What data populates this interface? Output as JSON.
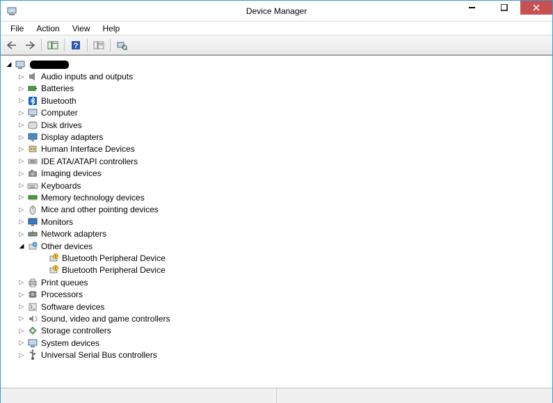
{
  "window": {
    "title": "Device Manager"
  },
  "menubar": {
    "items": [
      "File",
      "Action",
      "View",
      "Help"
    ]
  },
  "toolbar": {
    "buttons": [
      "back",
      "forward",
      "show-hide-console",
      "help",
      "properties",
      "scan-hardware"
    ]
  },
  "tree": {
    "root": {
      "label": "",
      "icon": "computer",
      "expanded": true,
      "redacted": true
    },
    "nodes": [
      {
        "label": "Audio inputs and outputs",
        "icon": "audio",
        "expanded": false,
        "children": []
      },
      {
        "label": "Batteries",
        "icon": "battery",
        "expanded": false,
        "children": []
      },
      {
        "label": "Bluetooth",
        "icon": "bluetooth",
        "expanded": false,
        "children": []
      },
      {
        "label": "Computer",
        "icon": "computer",
        "expanded": false,
        "children": []
      },
      {
        "label": "Disk drives",
        "icon": "disk",
        "expanded": false,
        "children": []
      },
      {
        "label": "Display adapters",
        "icon": "display",
        "expanded": false,
        "children": []
      },
      {
        "label": "Human Interface Devices",
        "icon": "hid",
        "expanded": false,
        "children": []
      },
      {
        "label": "IDE ATA/ATAPI controllers",
        "icon": "ide",
        "expanded": false,
        "children": []
      },
      {
        "label": "Imaging devices",
        "icon": "imaging",
        "expanded": false,
        "children": []
      },
      {
        "label": "Keyboards",
        "icon": "keyboard",
        "expanded": false,
        "children": []
      },
      {
        "label": "Memory technology devices",
        "icon": "memory",
        "expanded": false,
        "children": []
      },
      {
        "label": "Mice and other pointing devices",
        "icon": "mouse",
        "expanded": false,
        "children": []
      },
      {
        "label": "Monitors",
        "icon": "monitor",
        "expanded": false,
        "children": []
      },
      {
        "label": "Network adapters",
        "icon": "network",
        "expanded": false,
        "children": []
      },
      {
        "label": "Other devices",
        "icon": "other",
        "expanded": true,
        "children": [
          {
            "label": "Bluetooth Peripheral Device",
            "icon": "unknown"
          },
          {
            "label": "Bluetooth Peripheral Device",
            "icon": "unknown"
          }
        ]
      },
      {
        "label": "Print queues",
        "icon": "printer",
        "expanded": false,
        "children": []
      },
      {
        "label": "Processors",
        "icon": "cpu",
        "expanded": false,
        "children": []
      },
      {
        "label": "Software devices",
        "icon": "software",
        "expanded": false,
        "children": []
      },
      {
        "label": "Sound, video and game controllers",
        "icon": "sound",
        "expanded": false,
        "children": []
      },
      {
        "label": "Storage controllers",
        "icon": "storage",
        "expanded": false,
        "children": []
      },
      {
        "label": "System devices",
        "icon": "system",
        "expanded": false,
        "children": []
      },
      {
        "label": "Universal Serial Bus controllers",
        "icon": "usb",
        "expanded": false,
        "children": []
      }
    ]
  }
}
